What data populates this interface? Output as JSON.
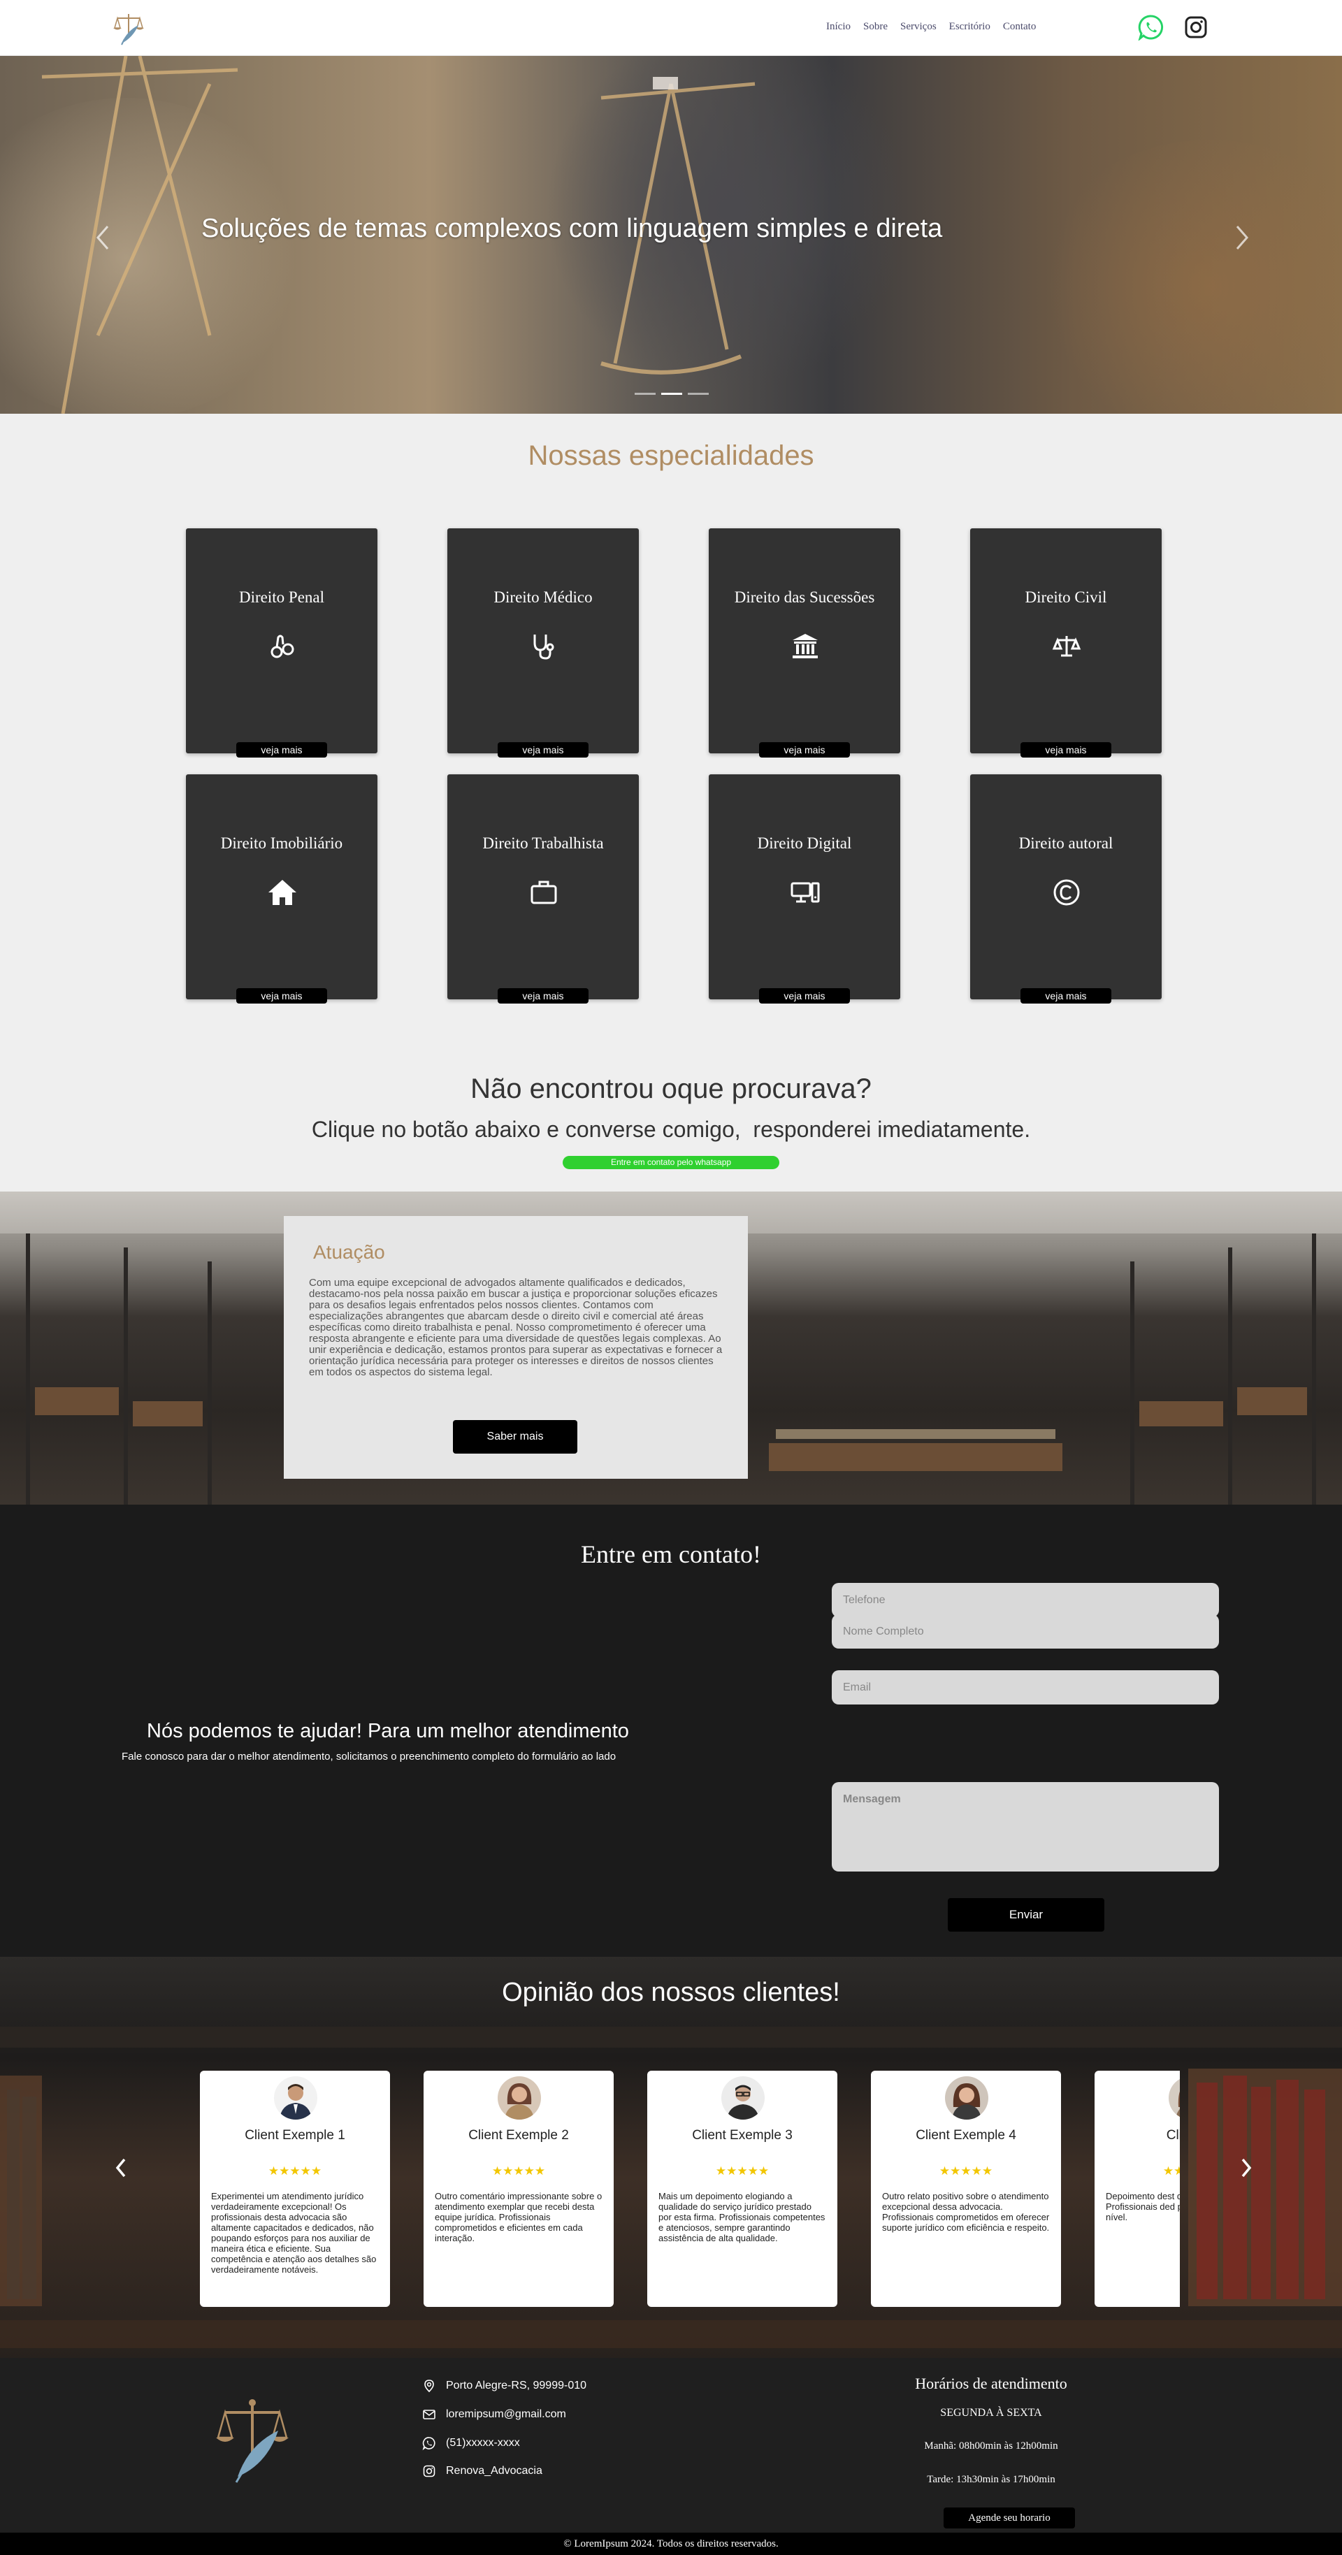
{
  "header": {
    "nav": [
      "Início",
      "Sobre",
      "Serviços",
      "Escritório",
      "Contato"
    ],
    "logo_icon": "scales-quill-logo",
    "whatsapp_icon": "whatsapp-icon",
    "instagram_icon": "instagram-icon"
  },
  "hero": {
    "title": "Soluções de temas complexos com linguagem simples e direta",
    "slides_total": 3,
    "active_slide": 2
  },
  "specialties": {
    "title": "Nossas especialidades",
    "button_label": "veja mais",
    "items": [
      {
        "title": "Direito Penal",
        "icon": "handcuffs-icon"
      },
      {
        "title": "Direito Médico",
        "icon": "stethoscope-icon"
      },
      {
        "title": "Direito das Sucessões",
        "icon": "building-columns-icon"
      },
      {
        "title": "Direito Civil",
        "icon": "scales-icon"
      },
      {
        "title": "Direito Imobiliário",
        "icon": "house-icon"
      },
      {
        "title": "Direito Trabalhista",
        "icon": "briefcase-icon"
      },
      {
        "title": "Direito Digital",
        "icon": "computer-icon"
      },
      {
        "title": "Direito autoral",
        "icon": "copyright-icon"
      }
    ]
  },
  "cta": {
    "title": "Não encontrou oque procurava?",
    "subtitle": "Clique no botão abaixo e converse comigo,  responderei imediatamente.",
    "button": "Entre em contato pelo whatsapp"
  },
  "atuacao": {
    "title": "Atuação",
    "text": "Com uma equipe excepcional de advogados altamente qualificados e dedicados, destacamo-nos pela nossa paixão em buscar a justiça e proporcionar soluções eficazes para os desafios legais enfrentados pelos nossos clientes. Contamos com especializações abrangentes que abarcam desde o direito civil e comercial até áreas específicas como direito trabalhista e penal. Nosso comprometimento é oferecer uma resposta abrangente e eficiente para uma diversidade de questões legais complexas. Ao unir experiência e dedicação, estamos prontos para superar as expectativas e fornecer a orientação jurídica necessária para proteger os interesses e direitos de nossos clientes em todos os aspectos do sistema legal.",
    "button": "Saber mais"
  },
  "contact": {
    "title": "Entre em contato!",
    "heading": "Nós podemos te ajudar! Para um melhor atendimento",
    "description": "Fale conosco para dar o melhor atendimento, solicitamos o preenchimento completo do formulário ao lado",
    "placeholders": {
      "name": "Nome Completo",
      "email": "Email",
      "phone": "Telefone",
      "message": "Mensagem"
    },
    "send_button": "Enviar"
  },
  "testimonials": {
    "title": "Opinião dos nossos clientes!",
    "stars": "★★★★★",
    "rating": 5,
    "items": [
      {
        "name": "Client Exemple 1",
        "text": "Experimentei um atendimento jurídico verdadeiramente excepcional! Os profissionais desta advocacia são altamente capacitados e dedicados, não poupando esforços para nos auxiliar de maneira ética e eficiente. Sua competência e atenção aos detalhes são verdadeiramente notáveis."
      },
      {
        "name": "Client Exemple 2",
        "text": "Outro comentário impressionante sobre o atendimento exemplar que recebi desta equipe jurídica. Profissionais comprometidos e eficientes em cada interação."
      },
      {
        "name": "Client Exemple 3",
        "text": "Mais um depoimento elogiando a qualidade do serviço jurídico prestado por esta firma. Profissionais competentes e atenciosos, sempre garantindo assistência de alta qualidade."
      },
      {
        "name": "Client Exemple 4",
        "text": "Outro relato positivo sobre o atendimento excepcional dessa advocacia. Profissionais comprometidos em oferecer suporte jurídico com eficiência e respeito."
      },
      {
        "name": "Client E",
        "text": "Depoimento dest do atendimento j Profissionais ded proporcionando u alto nível."
      }
    ]
  },
  "footer": {
    "address": "Porto Alegre-RS, 99999-010",
    "email": "loremipsum@gmail.com",
    "phone": "(51)xxxxx-xxxx",
    "instagram": "Renova_Advocacia",
    "hours_title": "Horários de atendimento",
    "days": "SEGUNDA À SEXTA",
    "morning": "Manhã: 08h00min às 12h00min",
    "afternoon": "Tarde: 13h30min às 17h00min",
    "schedule_button": "Agende seu horario",
    "copyright": "© LoremIpsum 2024. Todos os direitos reservados."
  },
  "colors": {
    "accent_gold": "#b08d63",
    "card_dark": "#323232",
    "whatsapp_green": "#2fd02f",
    "stars": "#f2c600",
    "section_dark": "#1b1b1b"
  }
}
